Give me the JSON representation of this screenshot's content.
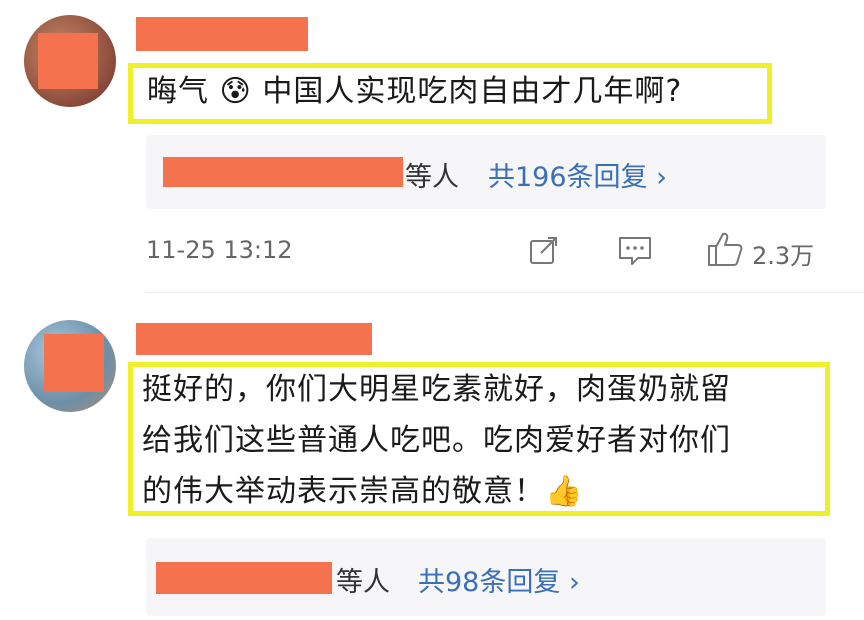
{
  "comments": [
    {
      "text": "晦气 😰 中国人实现吃肉自由才几年啊?",
      "reply_suffix": "等人",
      "reply_count": "共196条回复 ›",
      "timestamp": "11-25 13:12",
      "like_count": "2.3万"
    },
    {
      "lines": [
        "挺好的，你们大明星吃素就好，肉蛋奶就留",
        "给我们这些普通人吃吧。吃肉爱好者对你们",
        "的伟大举动表示崇高的敬意！👍"
      ],
      "reply_suffix": "等人",
      "reply_count": "共98条回复 ›"
    }
  ],
  "colors": {
    "redaction": "#f4734e",
    "highlight": "#f0f02a",
    "link": "#3b6fb6"
  },
  "icons": {
    "share": "share-icon",
    "comment": "comment-icon",
    "like": "thumbs-up-icon"
  }
}
